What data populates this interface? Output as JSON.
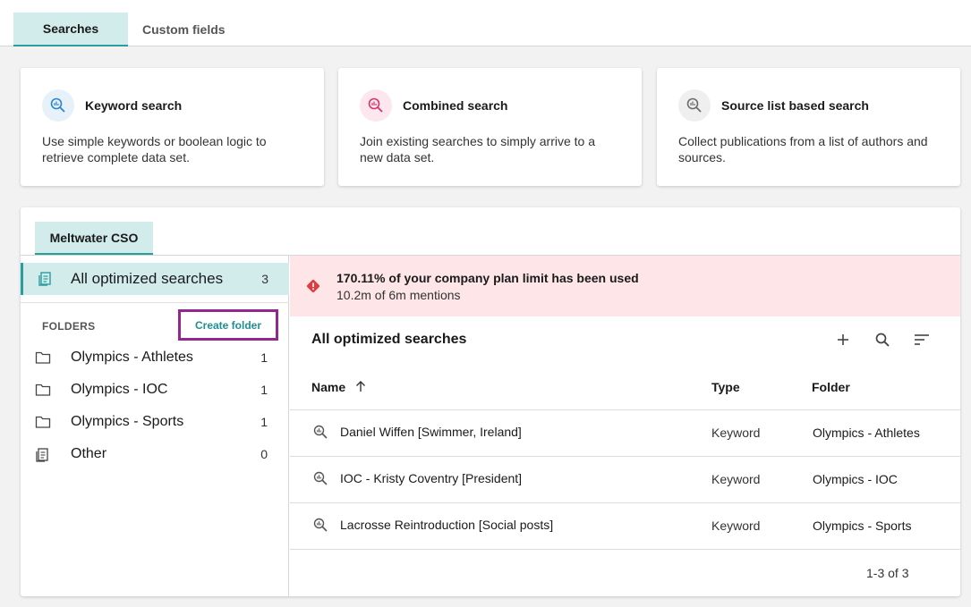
{
  "tabs": [
    {
      "label": "Searches"
    },
    {
      "label": "Custom fields"
    }
  ],
  "cards": [
    {
      "title": "Keyword search",
      "desc": "Use simple keywords or boolean logic to retrieve complete data set.",
      "icon": "keyword-search-icon",
      "accent": "#2a86c9",
      "bg": "#e7f1fa"
    },
    {
      "title": "Combined search",
      "desc": "Join existing searches to simply arrive to a new data set.",
      "icon": "combined-search-icon",
      "accent": "#d6336c",
      "bg": "#fde7ee"
    },
    {
      "title": "Source list based search",
      "desc": "Collect publications from a list of authors and sources.",
      "icon": "source-list-search-icon",
      "accent": "#6b6b6b",
      "bg": "#efefef"
    }
  ],
  "panel": {
    "tab_label": "Meltwater CSO"
  },
  "sidebar": {
    "all": {
      "label": "All optimized searches",
      "count": "3"
    },
    "folders_label": "FOLDERS",
    "create_folder": "Create folder",
    "folders": [
      {
        "label": "Olympics - Athletes",
        "count": "1",
        "icon": "folder-icon"
      },
      {
        "label": "Olympics - IOC",
        "count": "1",
        "icon": "folder-icon"
      },
      {
        "label": "Olympics - Sports",
        "count": "1",
        "icon": "folder-icon"
      },
      {
        "label": "Other",
        "count": "0",
        "icon": "document-icon"
      }
    ]
  },
  "alert": {
    "headline": "170.11% of your company plan limit has been used",
    "detail": "10.2m of 6m mentions",
    "color": "#e03e3e"
  },
  "list": {
    "title": "All optimized searches",
    "columns": {
      "name": "Name",
      "type": "Type",
      "folder": "Folder"
    },
    "rows": [
      {
        "name": "Daniel Wiffen [Swimmer, Ireland]",
        "type": "Keyword",
        "folder": "Olympics - Athletes"
      },
      {
        "name": "IOC - Kristy Coventry [President]",
        "type": "Keyword",
        "folder": "Olympics - IOC"
      },
      {
        "name": "Lacrosse Reintroduction [Social posts]",
        "type": "Keyword",
        "folder": "Olympics - Sports"
      }
    ],
    "pagination": "1-3 of 3"
  }
}
